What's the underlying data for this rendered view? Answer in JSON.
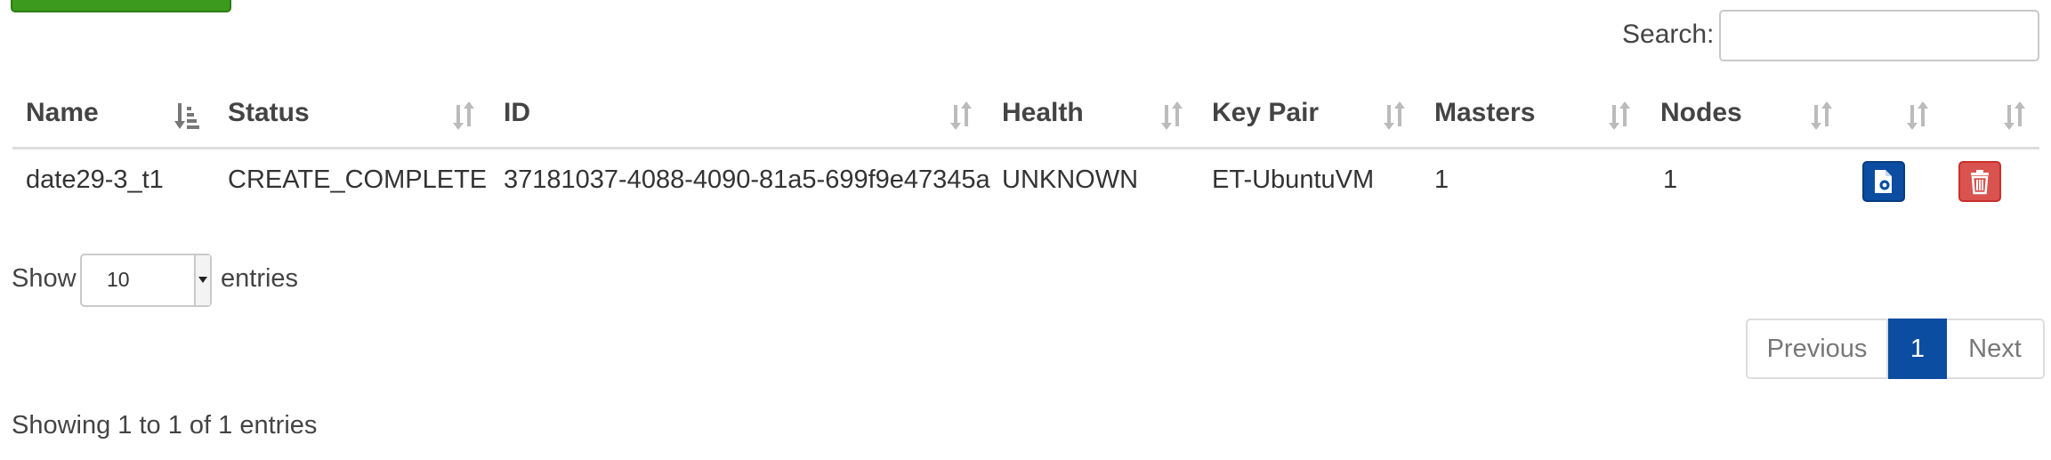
{
  "search": {
    "label": "Search:",
    "value": "",
    "placeholder": ""
  },
  "table": {
    "columns": [
      "Name",
      "Status",
      "ID",
      "Health",
      "Key Pair",
      "Masters",
      "Nodes",
      "",
      ""
    ],
    "rows": [
      {
        "name": "date29-3_t1",
        "status": "CREATE_COMPLETE",
        "id": "37181037-4088-4090-81a5-699f9e47345a",
        "health": "UNKNOWN",
        "key_pair": "ET-UbuntuVM",
        "masters": "1",
        "nodes": "1"
      }
    ],
    "sort": {
      "column": "Name",
      "direction": "ascending"
    },
    "action_icons": [
      "document-icon",
      "trash-icon"
    ]
  },
  "length": {
    "show_label": "Show",
    "value": "10",
    "entries_label": "entries"
  },
  "pagination": {
    "previous": "Previous",
    "current": "1",
    "next": "Next"
  },
  "info": "Showing 1 to 1 of 1 entries",
  "colors": {
    "primary": "#0b4da1",
    "danger": "#d9534f",
    "success": "#3c9a1f"
  }
}
